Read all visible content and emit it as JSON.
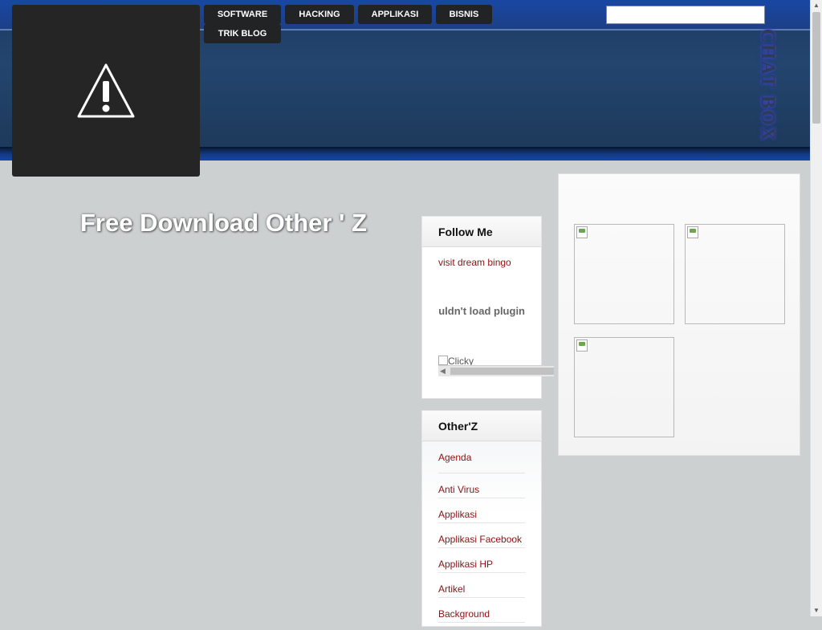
{
  "nav": {
    "items": [
      "SOFTWARE",
      "HACKING",
      "APPLIKASI",
      "BISNIS",
      "TRIK BLOG"
    ]
  },
  "search": {
    "value": "",
    "placeholder": ""
  },
  "chatbox": {
    "label": "CHAT BOX"
  },
  "page": {
    "title": "Free Download Other ' Z"
  },
  "follow_widget": {
    "heading": "Follow Me",
    "link": "visit dream bingo",
    "plugin_message": "Couldn't load plugin.",
    "clicky_alt": "Clicky"
  },
  "categories_widget": {
    "heading": "Other'Z",
    "items": [
      "Agenda",
      "Anti Virus",
      "Applikasi",
      "Applikasi Facebook",
      "Applikasi HP",
      "Artikel",
      "Background"
    ]
  },
  "colors": {
    "header_blue": "#1d3b63",
    "nav_button": "#222325",
    "link_red": "#8e1111",
    "page_background": "#cdd0d1"
  },
  "icons": {
    "logo": "warning-triangle-icon",
    "broken_image": "broken-image-icon"
  }
}
